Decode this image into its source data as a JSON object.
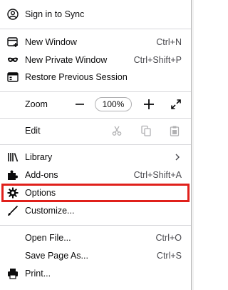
{
  "menu": {
    "sign_in": "Sign in to Sync",
    "new_window": {
      "label": "New Window",
      "shortcut": "Ctrl+N"
    },
    "new_private_window": {
      "label": "New Private Window",
      "shortcut": "Ctrl+Shift+P"
    },
    "restore_session": "Restore Previous Session",
    "zoom": {
      "label": "Zoom",
      "value": "100%"
    },
    "edit": "Edit",
    "library": "Library",
    "addons": {
      "label": "Add-ons",
      "shortcut": "Ctrl+Shift+A"
    },
    "options": "Options",
    "customize": "Customize...",
    "open_file": {
      "label": "Open File...",
      "shortcut": "Ctrl+O"
    },
    "save_page": {
      "label": "Save Page As...",
      "shortcut": "Ctrl+S"
    },
    "print": "Print..."
  },
  "highlight_color": "#e0201b"
}
